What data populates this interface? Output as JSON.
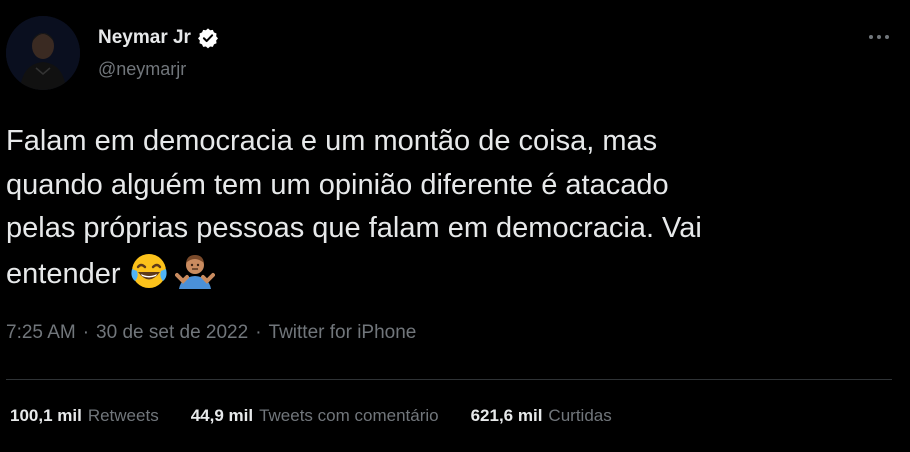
{
  "author": {
    "display_name": "Neymar Jr",
    "handle": "@neymarjr",
    "verified": true
  },
  "menu": {
    "icon": "more-dots-icon"
  },
  "tweet": {
    "text": "Falam em democracia e um montão de coisa, mas\nquando alguém tem um opinião diferente é atacado\npelas próprias pessoas que falam em democracia. Vai\nentender",
    "emojis": [
      "face-with-tears-of-joy-emoji",
      "person-shrugging-emoji"
    ]
  },
  "meta": {
    "time": "7:25 AM",
    "date": "30 de set de 2022",
    "source": "Twitter for iPhone",
    "separator": "·"
  },
  "stats": {
    "retweets": {
      "count": "100,1 mil",
      "label": "Retweets"
    },
    "quotes": {
      "count": "44,9 mil",
      "label": "Tweets com comentário"
    },
    "likes": {
      "count": "621,6 mil",
      "label": "Curtidas"
    }
  },
  "colors": {
    "background": "#000000",
    "text": "#e7e9ea",
    "secondary": "#71767b",
    "divider": "#2f3336",
    "verified_badge": "#ffffff"
  }
}
